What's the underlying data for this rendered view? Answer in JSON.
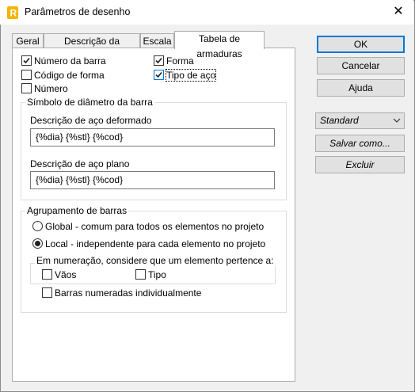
{
  "window": {
    "title": "Parâmetros de desenho",
    "icon": "revit-r-icon"
  },
  "tabs": [
    {
      "label": "Geral"
    },
    {
      "label": "Descrição da armadura"
    },
    {
      "label": "Escala"
    },
    {
      "label": "Tabela de armaduras",
      "active": true
    }
  ],
  "options": {
    "numero_barra": {
      "label": "Número da barra",
      "checked": true
    },
    "codigo_forma": {
      "label": "Código de forma",
      "checked": false
    },
    "numero": {
      "label": "Número",
      "checked": false
    },
    "forma": {
      "label": "Forma",
      "checked": true
    },
    "tipo_aco": {
      "label": "Tipo de aço",
      "checked": true
    }
  },
  "diameter_group": {
    "legend": "Símbolo de diâmetro da barra",
    "deformed_label": "Descrição de aço deformado",
    "deformed_value": "{%dia} {%stl} {%cod}",
    "plain_label": "Descrição de aço plano",
    "plain_value": "{%dia} {%stl} {%cod}"
  },
  "grouping": {
    "legend": "Agrupamento de barras",
    "global_label": "Global - comum para todos os elementos no projeto",
    "local_label": "Local - independente para cada elemento no projeto",
    "selected": "local",
    "numbering_legend": "Em numeração, considere que um elemento pertence a:",
    "vaos_label": "Vãos",
    "tipo_label": "Tipo",
    "individual_label": "Barras numeradas individualmente"
  },
  "buttons": {
    "ok": "OK",
    "cancel": "Cancelar",
    "help": "Ajuda",
    "save_as": "Salvar como...",
    "delete": "Excluir"
  },
  "style_combo": {
    "value": "Standard"
  },
  "colors": {
    "accent": "#0078d7",
    "icon": "#f5b400"
  }
}
